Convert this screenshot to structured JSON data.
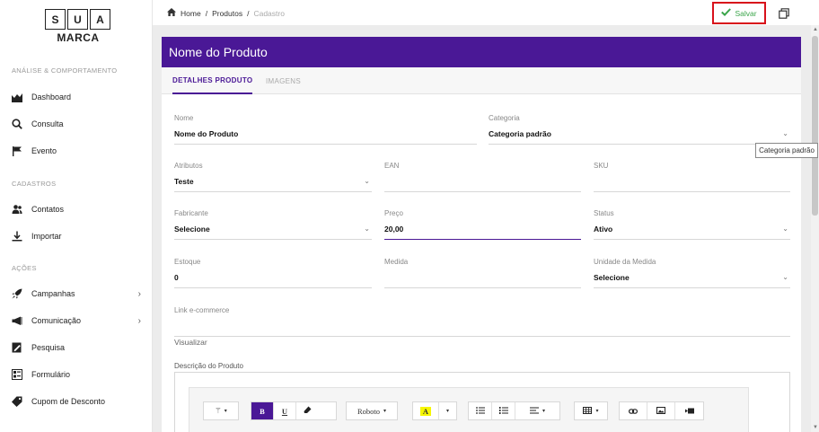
{
  "logo": {
    "letters": [
      "S",
      "U",
      "A"
    ],
    "sub": "MARCA"
  },
  "sidebar": {
    "sections": [
      {
        "title": "ANÁLISE & COMPORTAMENTO"
      },
      {
        "title": "CADASTROS"
      },
      {
        "title": "AÇÕES"
      }
    ],
    "items": [
      {
        "label": "Dashboard",
        "icon": "chart-area-icon"
      },
      {
        "label": "Consulta",
        "icon": "search-icon"
      },
      {
        "label": "Evento",
        "icon": "flag-icon"
      },
      {
        "label": "Contatos",
        "icon": "users-icon"
      },
      {
        "label": "Importar",
        "icon": "download-icon"
      },
      {
        "label": "Campanhas",
        "icon": "rocket-icon"
      },
      {
        "label": "Comunicação",
        "icon": "megaphone-icon"
      },
      {
        "label": "Pesquisa",
        "icon": "edit-icon"
      },
      {
        "label": "Formulário",
        "icon": "form-icon"
      },
      {
        "label": "Cupom de Desconto",
        "icon": "tag-icon"
      }
    ]
  },
  "breadcrumb": {
    "home": "Home",
    "sep": "/",
    "level1": "Produtos",
    "level2": "Cadastro"
  },
  "toolbar": {
    "save_label": "Salvar"
  },
  "card": {
    "title": "Nome do Produto"
  },
  "tabs": [
    {
      "label": "DETALHES PRODUTO"
    },
    {
      "label": "IMAGENS"
    }
  ],
  "form": {
    "nome": {
      "label": "Nome",
      "value": "Nome do Produto"
    },
    "categoria": {
      "label": "Categoria",
      "value": "Categoria padrão"
    },
    "atributos": {
      "label": "Atributos",
      "value": "Teste"
    },
    "ean": {
      "label": "EAN",
      "value": ""
    },
    "sku": {
      "label": "SKU",
      "value": ""
    },
    "fabricante": {
      "label": "Fabricante",
      "value": "Selecione"
    },
    "preco": {
      "label": "Preço",
      "value": "20,00"
    },
    "status": {
      "label": "Status",
      "value": "Ativo"
    },
    "estoque": {
      "label": "Estoque",
      "value": "0"
    },
    "medida": {
      "label": "Medida",
      "value": ""
    },
    "unidade": {
      "label": "Unidade da Medida",
      "value": "Selecione"
    },
    "link": {
      "label": "Link e-commerce",
      "value": ""
    },
    "visualizar": {
      "label": "Visualizar"
    },
    "descricao": {
      "label": "Descrição do Produto"
    }
  },
  "tooltip": {
    "text": "Categoria padrão"
  },
  "editor": {
    "font_name": "Roboto",
    "bold": "B",
    "underline": "U",
    "highlight": "A"
  },
  "colors": {
    "brand": "#4a1896",
    "save": "#3aa54a",
    "highlight_border": "#d8111b"
  }
}
